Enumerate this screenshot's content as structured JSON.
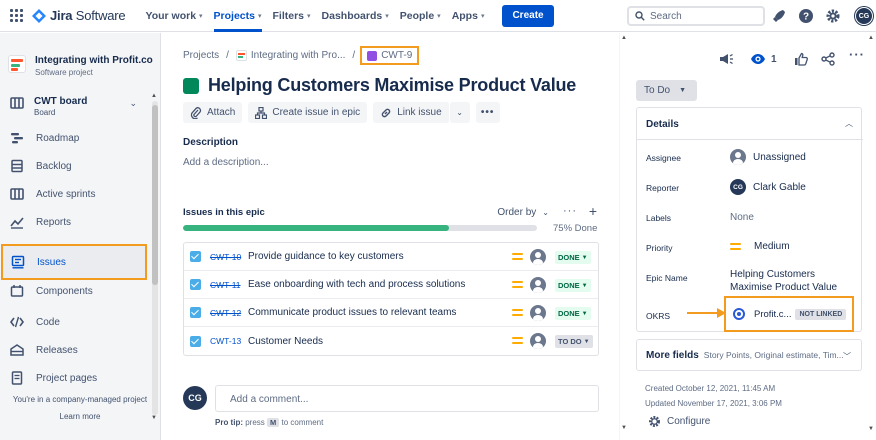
{
  "topnav": {
    "product_name_bold": "Jira",
    "product_name_soft": "Software",
    "items": [
      {
        "label": "Your work",
        "active": false
      },
      {
        "label": "Projects",
        "active": true
      },
      {
        "label": "Filters",
        "active": false
      },
      {
        "label": "Dashboards",
        "active": false
      },
      {
        "label": "People",
        "active": false
      },
      {
        "label": "Apps",
        "active": false
      }
    ],
    "create_label": "Create",
    "search_placeholder": "Search",
    "user_initials": "CG"
  },
  "sidebar": {
    "project_name": "Integrating with Profit.co",
    "project_type": "Software project",
    "board_title": "CWT board",
    "board_sub": "Board",
    "items": [
      {
        "label": "Roadmap",
        "icon": "roadmap-icon",
        "active": false
      },
      {
        "label": "Backlog",
        "icon": "backlog-icon",
        "active": false
      },
      {
        "label": "Active sprints",
        "icon": "active-sprints-icon",
        "active": false
      },
      {
        "label": "Reports",
        "icon": "reports-icon",
        "active": false
      },
      {
        "label": "Issues",
        "icon": "issues-icon",
        "active": true
      },
      {
        "label": "Components",
        "icon": "components-icon",
        "active": false
      },
      {
        "label": "Code",
        "icon": "code-icon",
        "active": false
      },
      {
        "label": "Releases",
        "icon": "releases-icon",
        "active": false
      },
      {
        "label": "Project pages",
        "icon": "project-pages-icon",
        "active": false
      }
    ],
    "footnote": "You're in a company-managed project",
    "learn_more": "Learn more"
  },
  "main": {
    "breadcrumb": {
      "projects": "Projects",
      "project": "Integrating with Pro...",
      "issue_key": "CWT-9"
    },
    "title": "Helping Customers Maximise Product Value",
    "actions": {
      "attach": "Attach",
      "create_in_epic": "Create issue in epic",
      "link_issue": "Link issue",
      "more": "•••"
    },
    "description_label": "Description",
    "description_placeholder": "Add a description...",
    "issues_label": "Issues in this epic",
    "order_by": "Order by",
    "progress_percent": 75,
    "progress_text": "75% Done",
    "issues": [
      {
        "key": "CWT-10",
        "summary": "Provide guidance to key customers",
        "status": "DONE",
        "done": true
      },
      {
        "key": "CWT-11",
        "summary": "Ease onboarding with tech and process solutions",
        "status": "DONE",
        "done": true
      },
      {
        "key": "CWT-12",
        "summary": "Communicate product issues to relevant teams",
        "status": "DONE",
        "done": true
      },
      {
        "key": "CWT-13",
        "summary": "Customer Needs",
        "status": "TO DO",
        "done": false
      }
    ],
    "comment": {
      "avatar_initials": "CG",
      "placeholder": "Add a comment...",
      "protip_prefix": "Pro tip:",
      "protip_press": "press",
      "protip_key": "M",
      "protip_suffix": "to comment"
    }
  },
  "right": {
    "watch_count": "1",
    "status_button": "To Do",
    "details_title": "Details",
    "fields": {
      "assignee_label": "Assignee",
      "assignee_value": "Unassigned",
      "reporter_label": "Reporter",
      "reporter_value": "Clark Gable",
      "reporter_initials": "CG",
      "labels_label": "Labels",
      "labels_value": "None",
      "priority_label": "Priority",
      "priority_value": "Medium",
      "epic_name_label": "Epic Name",
      "epic_name_value": "Helping Customers Maximise Product Value",
      "okrs_label": "OKRS",
      "okrs_value": "Profit.c...",
      "okrs_badge": "NOT LINKED"
    },
    "more_fields_title": "More fields",
    "more_fields_sub": "Story Points, Original estimate, Tim...",
    "created": "Created October 12, 2021, 11:45 AM",
    "updated": "Updated November 17, 2021, 3:06 PM",
    "configure": "Configure"
  },
  "colors": {
    "brand_blue": "#0052cc",
    "highlight_orange": "#f29b1f",
    "epic_green": "#00875a",
    "progress_green": "#36b37e",
    "priority_medium": "#ffab00"
  }
}
